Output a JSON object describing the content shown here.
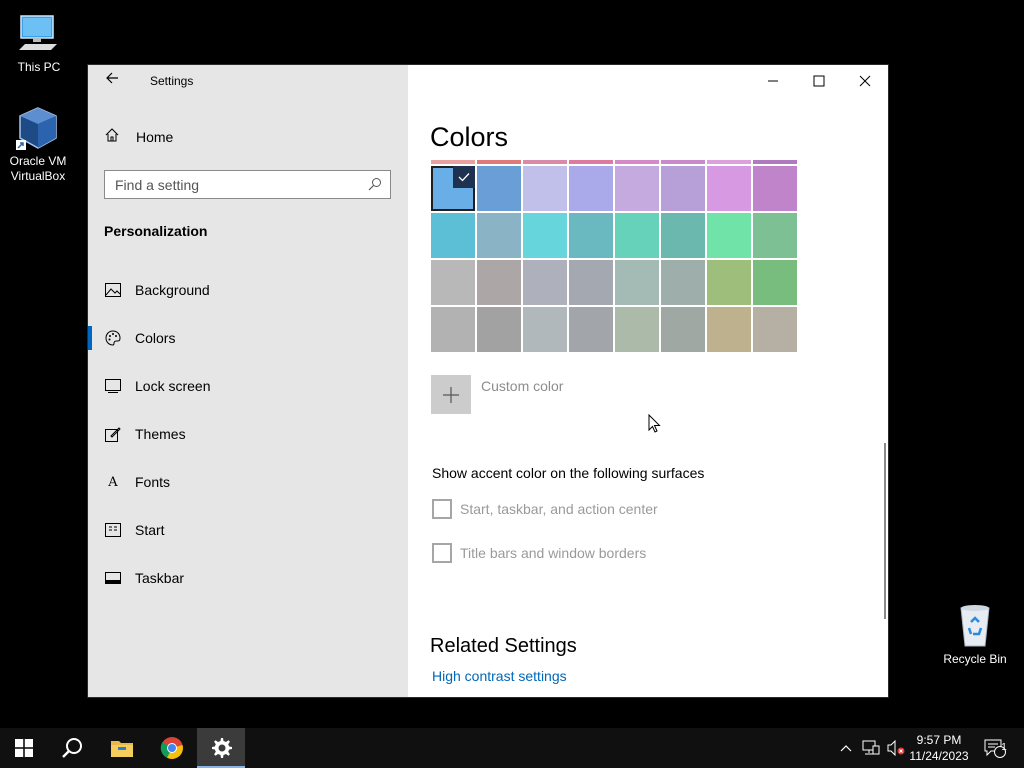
{
  "desktop": {
    "icons": [
      {
        "label": "This PC"
      },
      {
        "label": "Oracle VM\nVirtualBox"
      },
      {
        "label": "Recycle Bin"
      }
    ]
  },
  "window": {
    "app_title": "Settings",
    "sidebar": {
      "home_label": "Home",
      "search_placeholder": "Find a setting",
      "section_title": "Personalization",
      "items": [
        {
          "label": "Background",
          "icon": "picture-icon"
        },
        {
          "label": "Colors",
          "icon": "palette-icon",
          "selected": true
        },
        {
          "label": "Lock screen",
          "icon": "lock-screen-icon"
        },
        {
          "label": "Themes",
          "icon": "themes-icon"
        },
        {
          "label": "Fonts",
          "icon": "fonts-icon"
        },
        {
          "label": "Start",
          "icon": "start-icon"
        },
        {
          "label": "Taskbar",
          "icon": "taskbar-icon"
        }
      ]
    },
    "content": {
      "page_title": "Colors",
      "accent_swatches": {
        "top_strip": [
          "#e8a0a0",
          "#e07a7a",
          "#d98aa8",
          "#dc7aa0",
          "#d48ac6",
          "#c98ac9",
          "#dca0dc",
          "#b07ac0"
        ],
        "rows": [
          [
            "#6aaee8",
            "#6a9ed6",
            "#c0c0ea",
            "#aaaaea",
            "#c4aade",
            "#b7a0d8",
            "#d79ae2",
            "#bf84ca"
          ],
          [
            "#5cbfd6",
            "#8ab4c6",
            "#66d6dc",
            "#6ab8c0",
            "#66d2ba",
            "#6ab8ae",
            "#70e4a8",
            "#7cc094"
          ],
          [
            "#b8b8b8",
            "#aca6a6",
            "#aeb0bc",
            "#a4a8b0",
            "#a4bab4",
            "#9eaeaa",
            "#9ebe7c",
            "#78bc7e"
          ],
          [
            "#b2b2b2",
            "#a2a2a2",
            "#b0b8bc",
            "#a2a6aa",
            "#acbaaa",
            "#a0a8a4",
            "#beb28e",
            "#b6b0a4"
          ]
        ],
        "selected": [
          0,
          0
        ]
      },
      "custom_color_label": "Custom color",
      "accent_heading": "Show accent color on the following surfaces",
      "checkboxes": [
        {
          "label": "Start, taskbar, and action center",
          "checked": false
        },
        {
          "label": "Title bars and window borders",
          "checked": false
        }
      ],
      "related_title": "Related Settings",
      "related_link": "High contrast settings"
    }
  },
  "taskbar": {
    "buttons": [
      "windows-start-icon",
      "search-icon",
      "file-explorer-icon",
      "chrome-icon",
      "settings-gear-icon"
    ],
    "clock": {
      "time": "9:57 PM",
      "date": "11/24/2023"
    },
    "notification_count": "1"
  }
}
